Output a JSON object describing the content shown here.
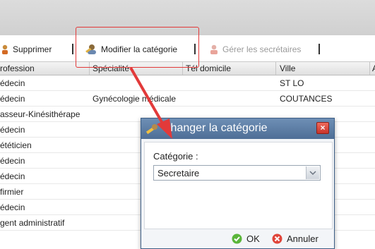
{
  "toolbar": {
    "delete_label": "Supprimer",
    "modify_label": "Modifier la catégorie",
    "manage_label": "Gérer les secrétaires"
  },
  "table": {
    "columns": [
      "rofession",
      "Spécialité",
      "Tél domicile",
      "Ville",
      "A"
    ],
    "rows": [
      [
        "édecin",
        "",
        "",
        "ST LO"
      ],
      [
        "édecin",
        "Gynécologie médicale",
        "",
        "COUTANCES"
      ],
      [
        "asseur-Kinésithérape",
        "",
        "",
        ""
      ],
      [
        "édecin",
        "",
        "",
        ""
      ],
      [
        "ététicien",
        "",
        "",
        ""
      ],
      [
        "édecin",
        "",
        "",
        ""
      ],
      [
        "édecin",
        "",
        "",
        ""
      ],
      [
        "firmier",
        "",
        "",
        ""
      ],
      [
        "édecin",
        "",
        "",
        ""
      ],
      [
        "gent administratif",
        "",
        "",
        ""
      ]
    ]
  },
  "dialog": {
    "title": "Changer la catégorie",
    "close": "×",
    "category_label": "Catégorie :",
    "category_value": "Secretaire",
    "ok_label": "OK",
    "cancel_label": "Annuler"
  },
  "colors": {
    "highlight": "#e23a3a",
    "title_bar": "#5a7aa2"
  }
}
